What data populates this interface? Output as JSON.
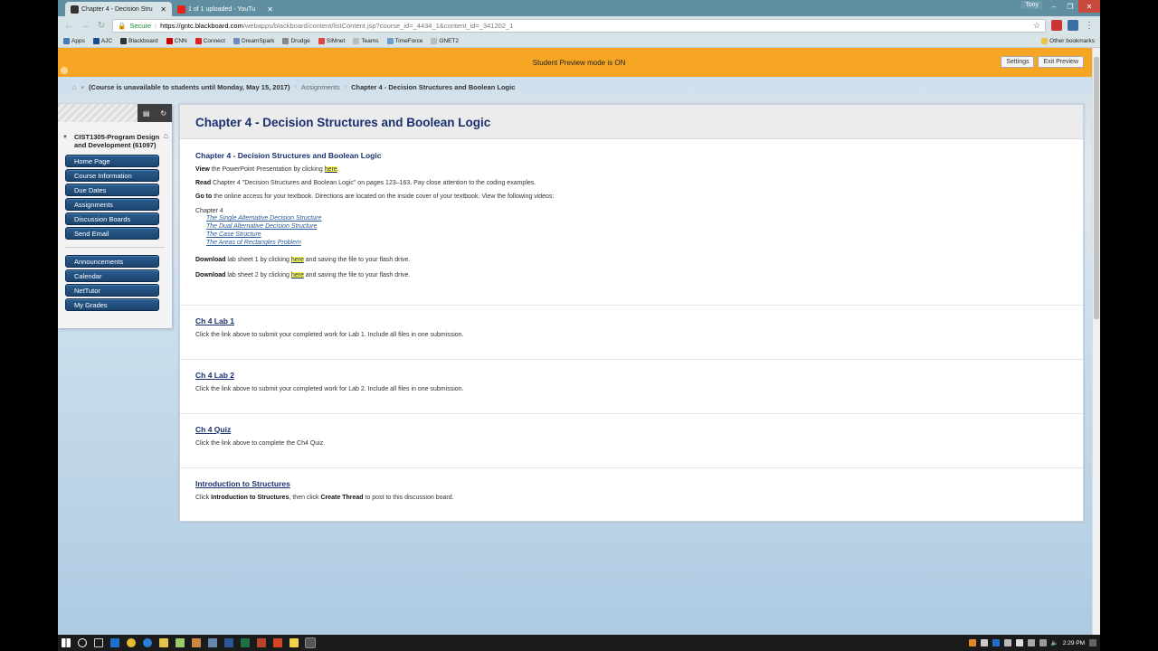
{
  "browser": {
    "tabs": [
      {
        "title": "Chapter 4 - Decision Stru",
        "active": true
      },
      {
        "title": "1 of 1 uploaded - YouTu",
        "active": false
      }
    ],
    "user": "Tony",
    "address": {
      "secure_label": "Secure",
      "host": "https://gntc.blackboard.com",
      "path": "/webapps/blackboard/content/listContent.jsp?course_id=_4434_1&content_id=_341202_1"
    },
    "bookmarks": [
      "Apps",
      "AJC",
      "Blackboard",
      "CNN",
      "Connect",
      "DreamSpark",
      "Drudge",
      "SIMnet",
      "Teams",
      "TimeForce",
      "GNET2"
    ],
    "other_bookmarks": "Other bookmarks"
  },
  "preview": {
    "message": "Student Preview mode is ON",
    "settings_label": "Settings",
    "exit_label": "Exit Preview"
  },
  "breadcrumb": {
    "course_notice": "(Course is unavailable to students until Monday, May 15, 2017)",
    "section": "Assignments",
    "current": "Chapter 4 - Decision Structures and Boolean Logic"
  },
  "course_menu": {
    "course_name": "CIST1305-Program Design and Development (61097)",
    "group1": [
      "Home Page",
      "Course Information",
      "Due Dates",
      "Assignments",
      "Discussion Boards",
      "Send Email"
    ],
    "group2": [
      "Announcements",
      "Calendar",
      "NetTutor",
      "My Grades"
    ]
  },
  "content": {
    "page_title": "Chapter 4 - Decision Structures and Boolean Logic",
    "item1": {
      "title": "Chapter 4 - Decision Structures and Boolean Logic",
      "view_bold": "View",
      "view_text": " the PowerPoint Presentation by clicking ",
      "here": "here",
      "period": ".",
      "read_bold": "Read",
      "read_text": " Chapter 4 \"Decision Structures and Boolean Logic\" on pages 123–163.  Pay close attention to the coding examples.",
      "goto_bold": "Go to",
      "goto_text": " the online access for your textbook. Directions are located on the inside cover of your textbook. View the following videos:",
      "chapter_label": "Chapter 4",
      "videos": [
        "The Single Alternative Decision Structure",
        "The Dual Alternative Decision Structure",
        "The Case Structure",
        "The Areas of Rectangles Problem"
      ],
      "dl_bold": "Download",
      "dl1_text": " lab sheet 1 by clicking ",
      "dl2_text": " lab sheet 2 by clicking ",
      "dl_suffix": " and saving the file to your flash drive."
    },
    "items": [
      {
        "title": "Ch 4 Lab 1",
        "desc": "Click the link above to submit your completed work for Lab 1. Include all files in one submission."
      },
      {
        "title": "Ch 4 Lab 2",
        "desc": "Click the link above to submit your completed work for Lab 2. Include all files in one submission."
      },
      {
        "title": "Ch 4 Quiz",
        "desc": "Click the link above to complete the Ch4 Quiz."
      }
    ],
    "item_last": {
      "title": "Introduction to Structures",
      "pre": "Click ",
      "bold1": "Introduction to Structures",
      "mid": ", then click ",
      "bold2": "Create Thread",
      "post": " to post to this discussion board."
    }
  },
  "taskbar": {
    "time": "2:29 PM"
  },
  "colors": {
    "preview_bar": "#f6a623",
    "menu_button": "#1b4570",
    "title_blue": "#1a2f6f",
    "highlight": "#ffff4d"
  }
}
